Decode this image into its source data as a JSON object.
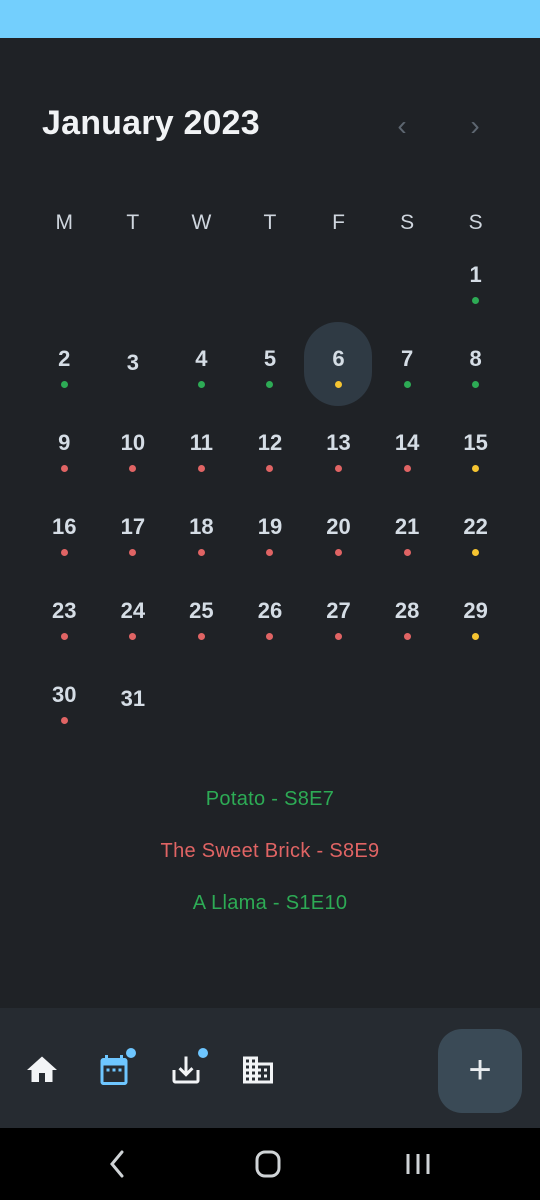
{
  "header": {
    "title": "January 2023",
    "prev": "‹",
    "next": "›"
  },
  "weekdays": [
    "M",
    "T",
    "W",
    "T",
    "F",
    "S",
    "S"
  ],
  "colors": {
    "green": "#2dab55",
    "red": "#e06464",
    "yellow": "#f5c431",
    "accent": "#6ec6ff"
  },
  "days": [
    {
      "n": "1",
      "dot": "green"
    },
    {
      "n": "2",
      "dot": "green"
    },
    {
      "n": "3",
      "dot": ""
    },
    {
      "n": "4",
      "dot": "green"
    },
    {
      "n": "5",
      "dot": "green"
    },
    {
      "n": "6",
      "dot": "yellow",
      "selected": true
    },
    {
      "n": "7",
      "dot": "green"
    },
    {
      "n": "8",
      "dot": "green"
    },
    {
      "n": "9",
      "dot": "red"
    },
    {
      "n": "10",
      "dot": "red"
    },
    {
      "n": "11",
      "dot": "red"
    },
    {
      "n": "12",
      "dot": "red"
    },
    {
      "n": "13",
      "dot": "red"
    },
    {
      "n": "14",
      "dot": "red"
    },
    {
      "n": "15",
      "dot": "yellow"
    },
    {
      "n": "16",
      "dot": "red"
    },
    {
      "n": "17",
      "dot": "red"
    },
    {
      "n": "18",
      "dot": "red"
    },
    {
      "n": "19",
      "dot": "red"
    },
    {
      "n": "20",
      "dot": "red"
    },
    {
      "n": "21",
      "dot": "red"
    },
    {
      "n": "22",
      "dot": "yellow"
    },
    {
      "n": "23",
      "dot": "red"
    },
    {
      "n": "24",
      "dot": "red"
    },
    {
      "n": "25",
      "dot": "red"
    },
    {
      "n": "26",
      "dot": "red"
    },
    {
      "n": "27",
      "dot": "red"
    },
    {
      "n": "28",
      "dot": "red"
    },
    {
      "n": "29",
      "dot": "yellow"
    },
    {
      "n": "30",
      "dot": "red"
    },
    {
      "n": "31",
      "dot": ""
    }
  ],
  "episodes": [
    {
      "text": "Potato - S8E7",
      "color": "green"
    },
    {
      "text": "The Sweet Brick - S8E9",
      "color": "red"
    },
    {
      "text": "A Llama - S1E10",
      "color": "green"
    }
  ],
  "bottom_nav": {
    "items": [
      "home-icon",
      "calendar-icon",
      "download-icon",
      "building-icon"
    ],
    "fab_label": "+"
  }
}
